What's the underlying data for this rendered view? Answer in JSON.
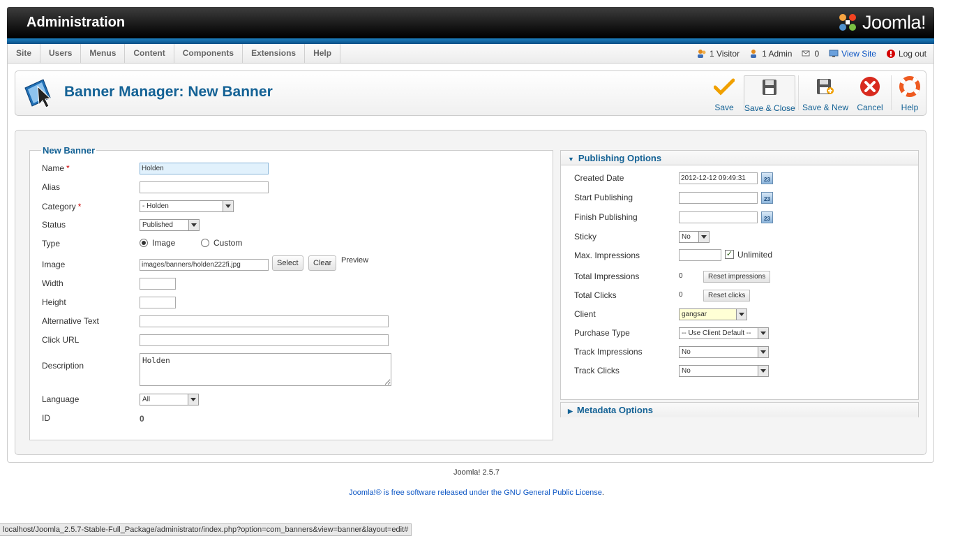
{
  "header": {
    "title": "Administration",
    "logo_text": "Joomla!"
  },
  "menu": [
    "Site",
    "Users",
    "Menus",
    "Content",
    "Components",
    "Extensions",
    "Help"
  ],
  "status": {
    "visitors": "1 Visitor",
    "admins": "1 Admin",
    "messages": "0",
    "view_site": "View Site",
    "logout": "Log out"
  },
  "toolbar": {
    "title": "Banner Manager: New Banner",
    "save": "Save",
    "save_close": "Save & Close",
    "save_new": "Save & New",
    "cancel": "Cancel",
    "help": "Help"
  },
  "form": {
    "legend": "New Banner",
    "name_label": "Name",
    "name_value": "Holden",
    "alias_label": "Alias",
    "alias_value": "",
    "category_label": "Category",
    "category_value": "- Holden",
    "status_label": "Status",
    "status_value": "Published",
    "type_label": "Type",
    "type_image": "Image",
    "type_custom": "Custom",
    "image_label": "Image",
    "image_value": "images/banners/holden222fi.jpg",
    "select_btn": "Select",
    "clear_btn": "Clear",
    "preview": "Preview",
    "width_label": "Width",
    "height_label": "Height",
    "alt_label": "Alternative Text",
    "click_label": "Click URL",
    "desc_label": "Description",
    "desc_value": "Holden",
    "language_label": "Language",
    "language_value": "All",
    "id_label": "ID",
    "id_value": "0",
    "required_mark": "*"
  },
  "publishing": {
    "title": "Publishing Options",
    "created_label": "Created Date",
    "created_value": "2012-12-12 09:49:31",
    "start_label": "Start Publishing",
    "finish_label": "Finish Publishing",
    "sticky_label": "Sticky",
    "sticky_value": "No",
    "max_imp_label": "Max. Impressions",
    "unlimited": "Unlimited",
    "total_imp_label": "Total Impressions",
    "total_imp_value": "0",
    "reset_imp": "Reset impressions",
    "total_clicks_label": "Total Clicks",
    "total_clicks_value": "0",
    "reset_clicks": "Reset clicks",
    "client_label": "Client",
    "client_value": "gangsar",
    "purchase_label": "Purchase Type",
    "purchase_value": "-- Use Client Default --",
    "track_imp_label": "Track Impressions",
    "track_imp_value": "No",
    "track_clicks_label": "Track Clicks",
    "track_clicks_value": "No",
    "calendar_text": "23"
  },
  "metadata": {
    "title": "Metadata Options"
  },
  "footer": {
    "version": "Joomla! 2.5.7",
    "lic_pre": "Joomla!® is free software released under the ",
    "lic_link": "GNU General Public License",
    "lic_post": "."
  },
  "statusbar": "localhost/Joomla_2.5.7-Stable-Full_Package/administrator/index.php?option=com_banners&view=banner&layout=edit#",
  "colors": {
    "accent": "#146295",
    "header_blue": "#1c80c0",
    "link": "#0b55c4"
  }
}
